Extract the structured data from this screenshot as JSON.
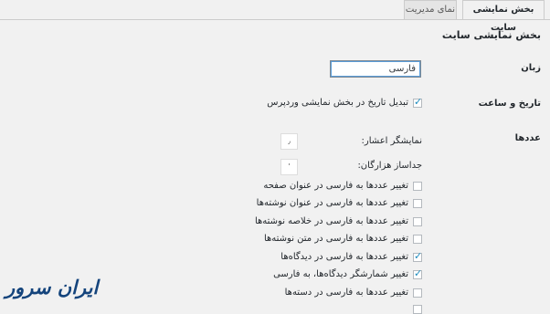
{
  "tabs": [
    {
      "label": "بخش نمایشی سایت",
      "active": true
    },
    {
      "label": "نمای مدیریت",
      "active": false
    }
  ],
  "section_title": "بخش نمایشی سایت",
  "language": {
    "label": "زبان",
    "value": "فارسی"
  },
  "datetime": {
    "label": "تاریخ و ساعت",
    "option": "تبدیل تاریخ در بخش نمایشی وردپرس",
    "checked": true
  },
  "numbers": {
    "label": "عددها",
    "decimal_label": "نمایشگر اعشار:",
    "decimal_value": "٫",
    "thousands_label": "جداساز هزارگان:",
    "thousands_value": "٬",
    "options": [
      {
        "label": "تغییر عددها به فارسی در عنوان صفحه",
        "checked": false
      },
      {
        "label": "تغییر عددها به فارسی در عنوان نوشته‌ها",
        "checked": false
      },
      {
        "label": "تغییر عددها به فارسی در خلاصه نوشته‌ها",
        "checked": false
      },
      {
        "label": "تغییر عددها به فارسی در متن نوشته‌ها",
        "checked": false
      },
      {
        "label": "تغییر عددها به فارسی در دیدگاه‌ها",
        "checked": true
      },
      {
        "label": "تغییر شمارشگر دیدگاه‌ها، به فارسی",
        "checked": true
      },
      {
        "label": "تغییر عددها به فارسی در دسته‌ها",
        "checked": false
      }
    ]
  },
  "logo_text": "ایران سرور",
  "colors": {
    "accent": "#1e8cbe",
    "logo": "#14447c",
    "background": "#f1f1f1"
  }
}
